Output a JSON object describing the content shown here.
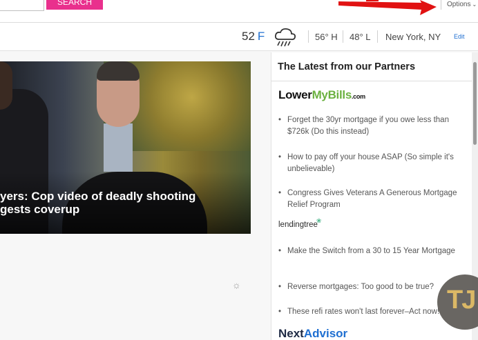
{
  "header": {
    "search_button": "SEARCH",
    "options_label": "Options"
  },
  "weather": {
    "temperature": "52",
    "unit": "F",
    "icon": "rain-cloud-icon",
    "high": "56° H",
    "low": "48° L",
    "location": "New York, NY",
    "edit_label": "Edit"
  },
  "hero": {
    "caption_line1": "yers: Cop video of deadly shooting",
    "caption_line2": "gests coverup"
  },
  "partners": {
    "title": "The Latest from our Partners",
    "brands": {
      "lowermybills_a": "Lower",
      "lowermybills_b": "MyBills",
      "lowermybills_c": ".com",
      "lendingtree": "lendingtree",
      "nextadvisor_a": "Next",
      "nextadvisor_b": "Advisor"
    },
    "links": [
      "Forget the 30yr mortgage if you owe less than $726k (Do this instead)",
      "How to pay off your house ASAP (So simple it's unbelievable)",
      "Congress Gives Veterans A Generous Mortgage Relief Program",
      "Make the Switch from a 30 to 15 Year Mortgage",
      "Reverse mortgages: Too good to be true?",
      "These refi rates won't last forever–Act now!"
    ]
  },
  "overlay": {
    "avatar_initials": "TJ"
  },
  "colors": {
    "search_button": "#e9308d",
    "accent_blue": "#1f6fd1",
    "lowermybills_green": "#6bb140"
  }
}
